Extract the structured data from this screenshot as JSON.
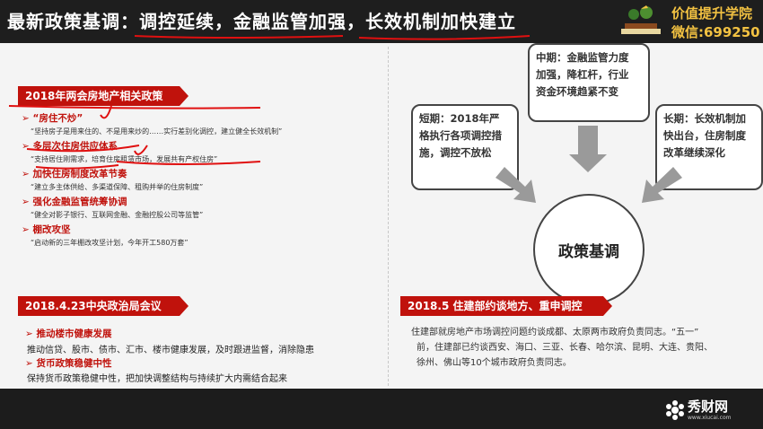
{
  "header": {
    "title": "最新政策基调：调控延续，金融监管加强，长效机制加快建立",
    "brand_line1": "价值提升学院",
    "brand_line2": "微信:699250"
  },
  "left": {
    "section1": {
      "header": "2018年两会房地产相关政策",
      "items": [
        {
          "title": "“房住不炒”",
          "desc": "“坚持房子是用来住的、不是用来炒的……实行差别化调控，建立健全长效机制”"
        },
        {
          "title": "多层次住房供应体系",
          "desc": "“支持居住刚需求，培育住房租赁市场，发展共有产权住房”"
        },
        {
          "title": "加快住房制度改革节奏",
          "desc": "“建立多主体供给、多渠道保障、租购并举的住房制度”"
        },
        {
          "title": "强化金融监管统筹协调",
          "desc": "“健全对影子银行、互联网金融、金融控股公司等监管”"
        },
        {
          "title": "棚改攻坚",
          "desc": "“启动新的三年棚改攻坚计划，今年开工580万套”"
        }
      ]
    },
    "section2": {
      "header": "2018.4.23中央政治局会议",
      "items": [
        {
          "title": "推动楼市健康发展",
          "desc": "推动信贷、股市、债市、汇市、楼市健康发展，及时跟进监督，消除隐患"
        },
        {
          "title": "货币政策稳健中性",
          "desc": "保持货币政策稳健中性，把加快调整结构与持续扩大内需结合起来"
        }
      ]
    }
  },
  "right": {
    "boxes": {
      "short": [
        "短期：2018年严",
        "格执行各项调控措",
        "施，调控不放松"
      ],
      "mid": [
        "中期：金融监管力度",
        "加强，降杠杆，行业",
        "资金环境趋紧不变"
      ],
      "long": [
        "长期：长效机制加",
        "快出台，住房制度",
        "改革继续深化"
      ]
    },
    "center": "政策基调",
    "section3": {
      "header": "2018.5 住建部约谈地方、重申调控",
      "lines": [
        "住建部就房地产市场调控问题约谈成都、太原两市政府负责同志。“五一”",
        "前，住建部已约谈西安、海口、三亚、长春、哈尔滨、昆明、大连、贵阳、",
        "徐州、佛山等10个城市政府负责同志。"
      ]
    }
  },
  "footer": {
    "brand": "秀财网",
    "url": "www.xiucai.com"
  },
  "colors": {
    "accent_red": "#c0120c",
    "brand_gold": "#f3c242",
    "annotation_red": "#e01010"
  }
}
